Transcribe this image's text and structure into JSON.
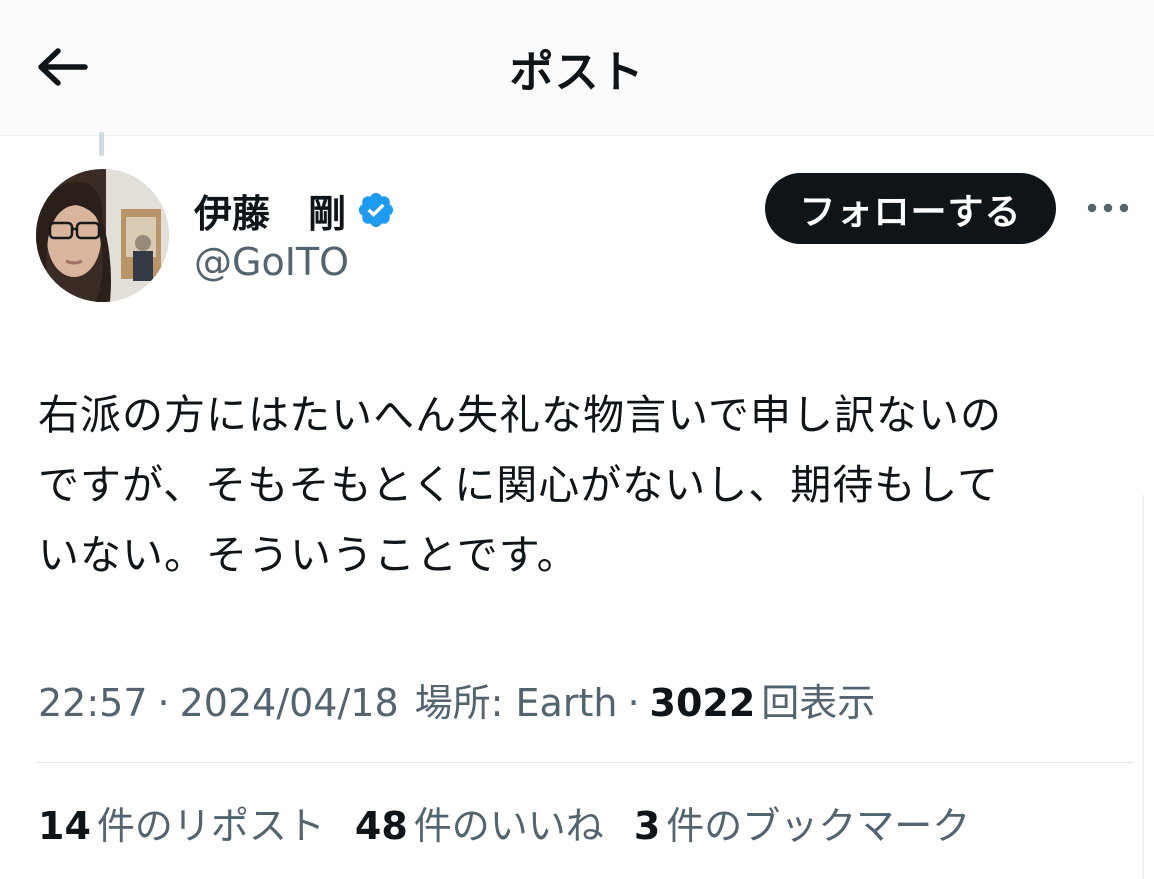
{
  "header": {
    "title": "ポスト",
    "back_icon": "arrow-left-icon"
  },
  "author": {
    "name": "伊藤　剛",
    "handle": "@GoITO",
    "verified": true,
    "verified_color": "#1d9bf0"
  },
  "actions": {
    "follow_label": "フォローする",
    "more_icon": "more-horizontal-icon"
  },
  "tweet": {
    "lines": [
      "右派の方にはたいへん失礼な物言いで申し訳ないの",
      "ですが、そもそもとくに関心がないし、期待もして",
      "いない。そういうことです。"
    ]
  },
  "meta": {
    "time": "22:57",
    "sep1": "·",
    "date": "2024/04/18",
    "location": "場所: Earth",
    "sep2": "·",
    "views_count": "3022",
    "views_label": "回表示"
  },
  "stats": {
    "reposts_count": "14",
    "reposts_label": "件のリポスト",
    "likes_count": "48",
    "likes_label": "件のいいね",
    "bookmarks_count": "3",
    "bookmarks_label": "件のブックマーク"
  },
  "colors": {
    "text_primary": "#0f1419",
    "text_secondary": "#536471",
    "follow_bg": "#0f1419"
  }
}
